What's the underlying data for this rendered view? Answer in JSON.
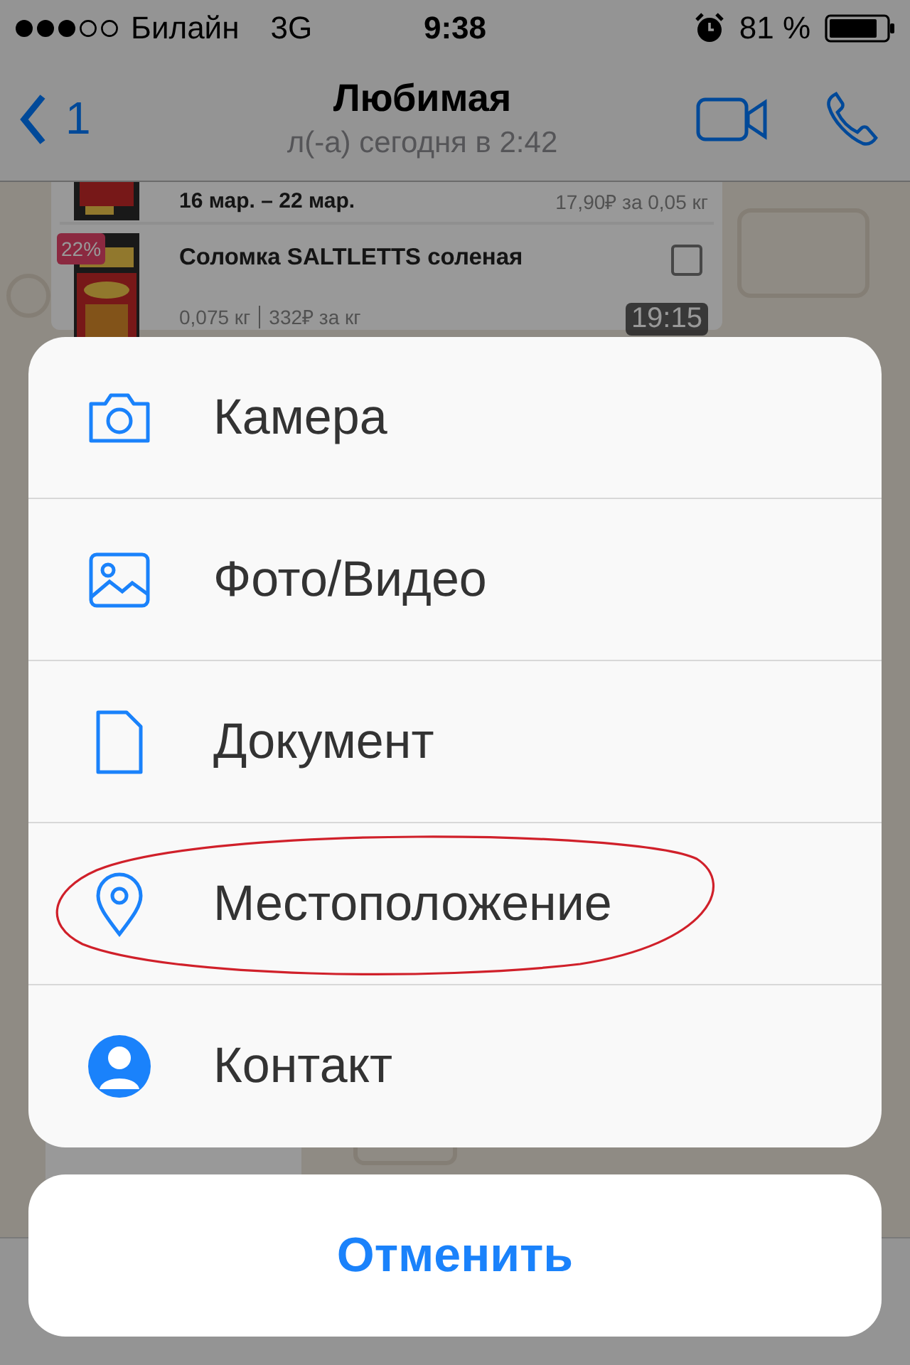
{
  "status_bar": {
    "carrier": "Билайн",
    "network": "3G",
    "time": "9:38",
    "battery": "81 %"
  },
  "header": {
    "back_count": "1",
    "title": "Любимая",
    "subtitle": "л(-а) сегодня в 2:42"
  },
  "chat": {
    "product_card": {
      "prev_dates": "16 мар. – 22 мар.",
      "prev_unit_price": "17,90₽ за 0,05 кг",
      "discount": "22%",
      "title": "Соломка SALTLETTS соленая",
      "checked": false,
      "weight": "0,075 кг",
      "price_per_kg": "332₽ за кг",
      "time": "19:15"
    }
  },
  "action_sheet": {
    "items": [
      {
        "kind": "camera",
        "label": "Камера",
        "circled": false
      },
      {
        "label": "Фото/Видео",
        "circled": false
      },
      {
        "kind": "document",
        "label": "Документ",
        "circled": false
      },
      {
        "kind": "location",
        "label": "Местоположение",
        "circled": true
      },
      {
        "kind": "contact",
        "label": "Контакт",
        "circled": false
      }
    ],
    "cancel": "Отменить"
  }
}
